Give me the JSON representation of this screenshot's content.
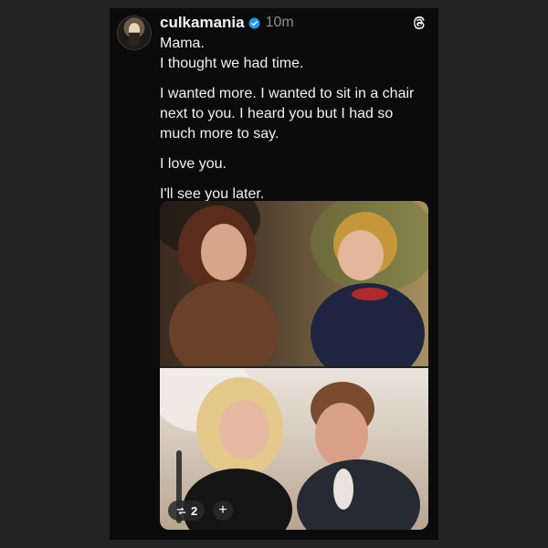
{
  "post": {
    "username": "culkamania",
    "time": "10m",
    "lines": [
      "Mama.",
      "I thought we had time.",
      "I wanted more. I wanted to sit in a chair next to you. I heard you but I had so much more to say.",
      "I love you.",
      "I'll see you later."
    ]
  },
  "media": {
    "images": [
      "top-photo",
      "bottom-photo"
    ],
    "repost_count": "2",
    "add_label": "+"
  },
  "icons": {
    "verified": "verified-badge-icon",
    "threads": "threads-logo-icon",
    "repost": "repost-icon"
  },
  "colors": {
    "card_bg": "#0b0b0b",
    "page_bg": "#232323",
    "verified_blue": "#1d9bf0",
    "muted_text": "#8d8d8d"
  }
}
